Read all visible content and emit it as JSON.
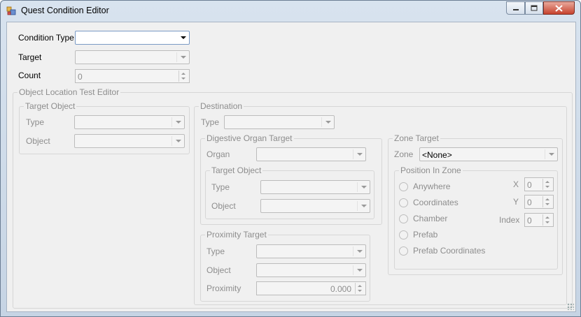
{
  "window": {
    "title": "Quest Condition Editor"
  },
  "form": {
    "condition_type": {
      "label": "Condition Type",
      "value": ""
    },
    "target": {
      "label": "Target",
      "value": ""
    },
    "count": {
      "label": "Count",
      "value": "0"
    }
  },
  "olte": {
    "title": "Object Location Test Editor",
    "target_object": {
      "title": "Target Object",
      "type_label": "Type",
      "object_label": "Object"
    },
    "destination": {
      "title": "Destination",
      "type_label": "Type",
      "digestive": {
        "title": "Digestive Organ Target",
        "organ_label": "Organ",
        "target_object": {
          "title": "Target Object",
          "type_label": "Type",
          "object_label": "Object"
        }
      },
      "proximity": {
        "title": "Proximity Target",
        "type_label": "Type",
        "object_label": "Object",
        "proximity_label": "Proximity",
        "proximity_value": "0.000"
      },
      "zone": {
        "title": "Zone Target",
        "zone_label": "Zone",
        "zone_value": "<None>",
        "position": {
          "title": "Position In Zone",
          "options": [
            "Anywhere",
            "Coordinates",
            "Chamber",
            "Prefab",
            "Prefab Coordinates"
          ],
          "x_label": "X",
          "x_value": "0",
          "y_label": "Y",
          "y_value": "0",
          "index_label": "Index",
          "index_value": "0"
        }
      }
    }
  },
  "colors": {
    "disabled_text": "#8d8d8d",
    "close_button": "#c7432e"
  }
}
